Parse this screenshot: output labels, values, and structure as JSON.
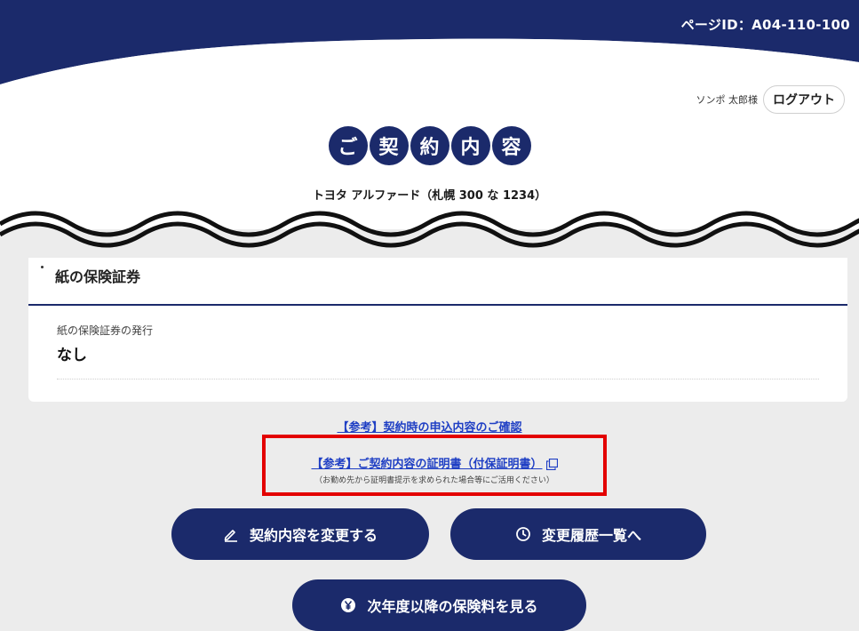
{
  "header": {
    "page_id": "ページID：A04-110-100",
    "user_name": "ソンポ 太郎様",
    "logout_label": "ログアウト"
  },
  "title": {
    "chars": [
      "ご",
      "契",
      "約",
      "内",
      "容"
    ]
  },
  "vehicle": "トヨタ アルファード（札幌 300 な 1234）",
  "card": {
    "title": "紙の保険証券",
    "field_label": "紙の保険証券の発行",
    "field_value": "なし"
  },
  "links": {
    "application_review": "【参考】契約時の申込内容のご確認",
    "certificate": "【参考】ご契約内容の証明書（付保証明書）",
    "certificate_note": "（お勤め先から証明書提示を求められた場合等にご活用ください）"
  },
  "buttons": {
    "change_contract": "契約内容を変更する",
    "history": "変更履歴一覧へ",
    "future_premium": "次年度以降の保険料を見る"
  },
  "colors": {
    "brand_navy": "#1b2a6b",
    "link_blue": "#1f3fc4",
    "highlight_red": "#e30000"
  }
}
